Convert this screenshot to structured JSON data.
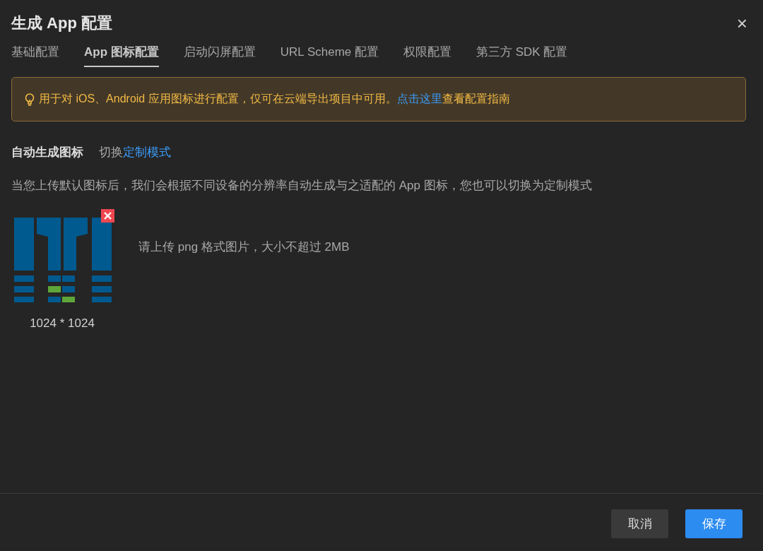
{
  "dialog": {
    "title": "生成 App 配置",
    "close": "×"
  },
  "tabs": [
    {
      "label": "基础配置",
      "selected": false
    },
    {
      "label": "App 图标配置",
      "selected": true
    },
    {
      "label": "启动闪屏配置",
      "selected": false
    },
    {
      "label": "URL Scheme 配置",
      "selected": false
    },
    {
      "label": "权限配置",
      "selected": false
    },
    {
      "label": "第三方 SDK 配置",
      "selected": false
    }
  ],
  "notice": {
    "text": "用于对 iOS、Android 应用图标进行配置，仅可在云端导出项目中可用。",
    "link": "点击这里",
    "text_after": "查看配置指南"
  },
  "section": {
    "heading": "自动生成图标",
    "switch_prefix": "切换",
    "switch_link": "定制模式",
    "description": "当您上传默认图标后，我们会根据不同设备的分辨率自动生成与之适配的 App 图标，您也可以切换为定制模式"
  },
  "upload": {
    "size": "1024 * 1024",
    "hint": "请上传 png 格式图片，大小不超过 2MB"
  },
  "buttons": [
    {
      "label": "取消",
      "kind": "secondary"
    },
    {
      "label": "保存",
      "kind": "primary"
    }
  ]
}
